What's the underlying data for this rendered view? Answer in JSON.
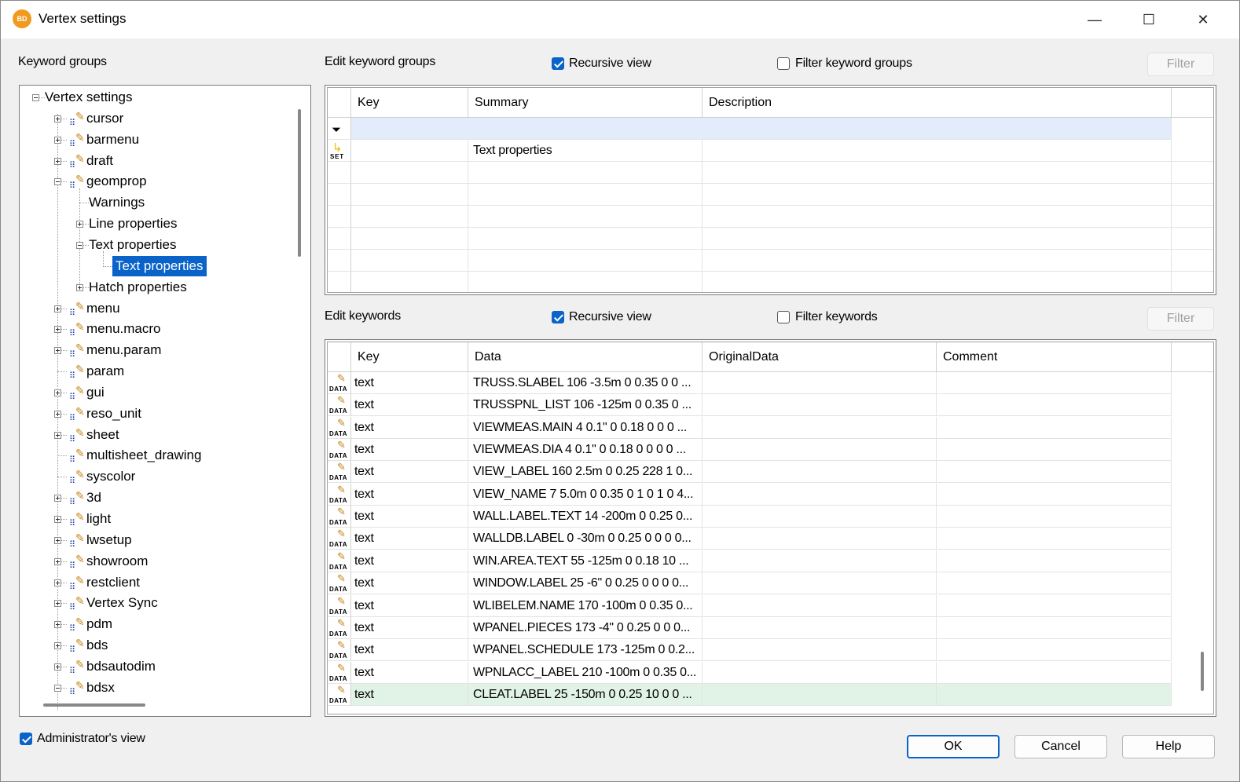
{
  "window": {
    "title": "Vertex settings",
    "app_icon": "BD",
    "minimize": "—",
    "maximize": "☐",
    "close": "✕"
  },
  "left": {
    "title": "Keyword groups",
    "tree": [
      {
        "label": "Vertex settings",
        "level": 0,
        "expander": "minus",
        "icon": false
      },
      {
        "label": "cursor",
        "level": 1,
        "expander": "plus",
        "icon": true
      },
      {
        "label": "barmenu",
        "level": 1,
        "expander": "plus",
        "icon": true
      },
      {
        "label": "draft",
        "level": 1,
        "expander": "plus",
        "icon": true
      },
      {
        "label": "geomprop",
        "level": 1,
        "expander": "minus",
        "icon": true
      },
      {
        "label": "Warnings",
        "level": 2,
        "expander": "none",
        "icon": false
      },
      {
        "label": "Line properties",
        "level": 2,
        "expander": "plus",
        "icon": false
      },
      {
        "label": "Text properties",
        "level": 2,
        "expander": "minus",
        "icon": false
      },
      {
        "label": "Text properties",
        "level": 3,
        "expander": "none",
        "icon": false,
        "selected": true
      },
      {
        "label": "Hatch properties",
        "level": 2,
        "expander": "plus",
        "icon": false
      },
      {
        "label": "menu",
        "level": 1,
        "expander": "plus",
        "icon": true
      },
      {
        "label": "menu.macro",
        "level": 1,
        "expander": "plus",
        "icon": true
      },
      {
        "label": "menu.param",
        "level": 1,
        "expander": "plus",
        "icon": true
      },
      {
        "label": "param",
        "level": 1,
        "expander": "none",
        "icon": true
      },
      {
        "label": "gui",
        "level": 1,
        "expander": "plus",
        "icon": true
      },
      {
        "label": "reso_unit",
        "level": 1,
        "expander": "plus",
        "icon": true
      },
      {
        "label": "sheet",
        "level": 1,
        "expander": "plus",
        "icon": true
      },
      {
        "label": "multisheet_drawing",
        "level": 1,
        "expander": "none",
        "icon": true
      },
      {
        "label": "syscolor",
        "level": 1,
        "expander": "none",
        "icon": true
      },
      {
        "label": "3d",
        "level": 1,
        "expander": "plus",
        "icon": true
      },
      {
        "label": "light",
        "level": 1,
        "expander": "plus",
        "icon": true
      },
      {
        "label": "lwsetup",
        "level": 1,
        "expander": "plus",
        "icon": true
      },
      {
        "label": "showroom",
        "level": 1,
        "expander": "plus",
        "icon": true
      },
      {
        "label": "restclient",
        "level": 1,
        "expander": "plus",
        "icon": true
      },
      {
        "label": "Vertex Sync",
        "level": 1,
        "expander": "plus",
        "icon": true
      },
      {
        "label": "pdm",
        "level": 1,
        "expander": "plus",
        "icon": true
      },
      {
        "label": "bds",
        "level": 1,
        "expander": "plus",
        "icon": true
      },
      {
        "label": "bdsautodim",
        "level": 1,
        "expander": "plus",
        "icon": true
      },
      {
        "label": "bdsx",
        "level": 1,
        "expander": "minus",
        "icon": true
      }
    ],
    "admin_label": "Administrator's view",
    "admin_checked": true
  },
  "groups": {
    "title": "Edit keyword groups",
    "recursive_label": "Recursive view",
    "recursive_checked": true,
    "filter_check_label": "Filter keyword groups",
    "filter_checked": false,
    "filter_button": "Filter",
    "columns": [
      "Key",
      "Summary",
      "Description"
    ],
    "rows": [
      {
        "key": "",
        "summary": "Text properties",
        "description": ""
      }
    ]
  },
  "keywords": {
    "title": "Edit keywords",
    "recursive_label": "Recursive view",
    "recursive_checked": true,
    "filter_check_label": "Filter keywords",
    "filter_checked": false,
    "filter_button": "Filter",
    "columns": [
      "Key",
      "Data",
      "OriginalData",
      "Comment"
    ],
    "rows": [
      {
        "key": "text",
        "data": "TRUSS.SLABEL 106 -3.5m 0 0.35 0 0 ..."
      },
      {
        "key": "text",
        "data": "TRUSSPNL_LIST 106 -125m 0 0.35 0 ..."
      },
      {
        "key": "text",
        "data": "VIEWMEAS.MAIN 4 0.1\" 0 0.18 0 0 0 ..."
      },
      {
        "key": "text",
        "data": "VIEWMEAS.DIA 4 0.1\" 0 0.18 0 0 0 0 ..."
      },
      {
        "key": "text",
        "data": "VIEW_LABEL 160 2.5m 0 0.25 228 1 0..."
      },
      {
        "key": "text",
        "data": "VIEW_NAME 7 5.0m 0 0.35 0 1 0 1 0 4..."
      },
      {
        "key": "text",
        "data": "WALL.LABEL.TEXT 14 -200m 0 0.25 0..."
      },
      {
        "key": "text",
        "data": "WALLDB.LABEL 0 -30m 0 0.25 0 0 0 0..."
      },
      {
        "key": "text",
        "data": "WIN.AREA.TEXT 55 -125m 0 0.18 10 ..."
      },
      {
        "key": "text",
        "data": "WINDOW.LABEL 25 -6\" 0 0.25 0 0 0 0..."
      },
      {
        "key": "text",
        "data": "WLIBELEM.NAME 170 -100m 0 0.35 0..."
      },
      {
        "key": "text",
        "data": "WPANEL.PIECES 173 -4\" 0 0.25 0 0 0..."
      },
      {
        "key": "text",
        "data": "WPANEL.SCHEDULE 173 -125m 0 0.2..."
      },
      {
        "key": "text",
        "data": "WPNLACC_LABEL 210 -100m 0 0.35 0..."
      },
      {
        "key": "text",
        "data": "CLEAT.LABEL 25 -150m 0 0.25 10 0 0 ...",
        "highlight": true
      }
    ]
  },
  "icons": {
    "data_badge": "DATA",
    "set_badge": "SET",
    "filter_row_icon": "filter-icon"
  },
  "buttons": {
    "ok": "OK",
    "cancel": "Cancel",
    "help": "Help"
  },
  "colors": {
    "selection": "#0a63c9",
    "filter_row": "#e3ecfb",
    "highlight_row": "#e1f3e6",
    "accent": "#0a63c9"
  }
}
